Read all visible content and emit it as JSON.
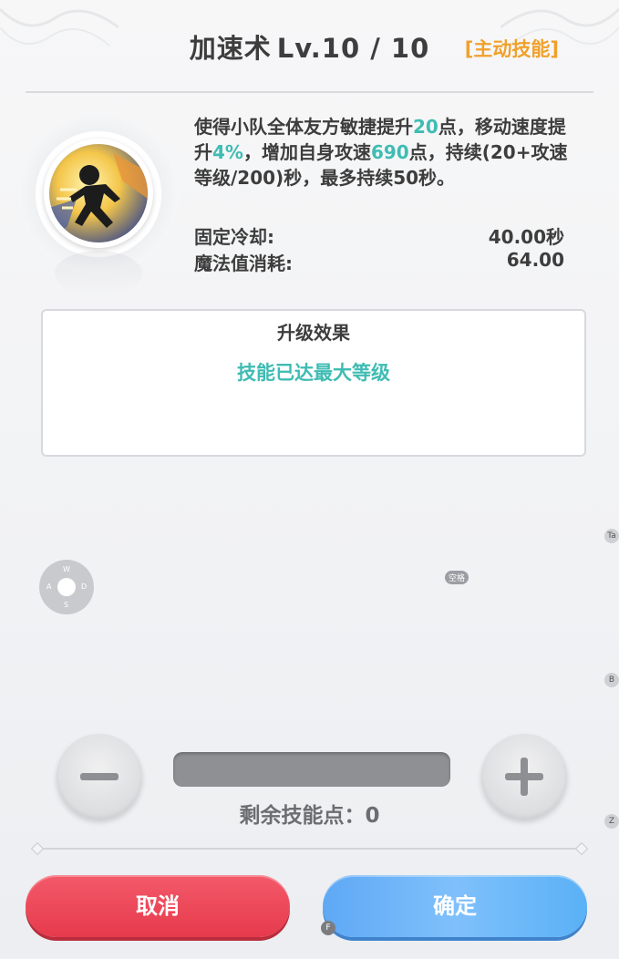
{
  "header": {
    "skill_name": "加速术",
    "level_text": "Lv.10 / 10",
    "skill_type": "[主动技能]"
  },
  "skill": {
    "icon": "running-figure-icon",
    "description": {
      "p1": "使得小队全体友方敏捷提升",
      "v1": "20",
      "p2": "点，移动速度提升",
      "v2": "4%",
      "p3": "，增加自身攻速",
      "v3": "690",
      "p4": "点，持续(20+攻速等级/200)秒，最多持续50秒。"
    },
    "stats": [
      {
        "label": "固定冷却:",
        "value": "40.00秒"
      },
      {
        "label": "魔法值消耗:",
        "value": "64.00"
      }
    ]
  },
  "upgrade": {
    "title": "升级效果",
    "message": "技能已达最大等级"
  },
  "controls": {
    "dpad": {
      "up": "W",
      "left": "A",
      "right": "D",
      "down": "S"
    },
    "key_hint": "空格",
    "side_keys": [
      "Ta",
      "B",
      "Z"
    ],
    "remaining_label": "剩余技能点：",
    "remaining_value": "0"
  },
  "buttons": {
    "cancel": "取消",
    "confirm": "确定",
    "confirm_key": "F"
  },
  "colors": {
    "highlight": "#3fbcb3",
    "tag": "#f0a12b",
    "cancel": "#e63a4c",
    "confirm": "#6fb6f8"
  }
}
